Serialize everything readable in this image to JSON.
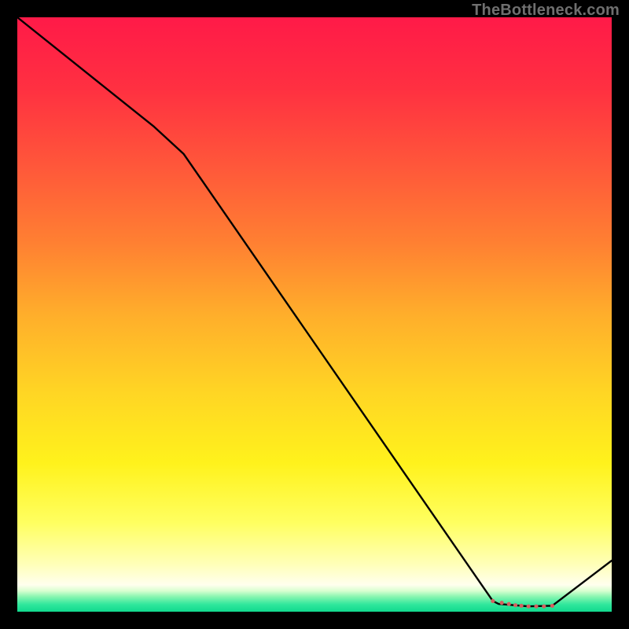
{
  "watermark": "TheBottleneck.com",
  "chart_data": {
    "type": "line",
    "title": "",
    "xlabel": "",
    "ylabel": "",
    "xlim": [
      0,
      100
    ],
    "ylim": [
      0,
      100
    ],
    "background_gradient": {
      "stops": [
        {
          "offset": 0.0,
          "color": "#ff1a48"
        },
        {
          "offset": 0.12,
          "color": "#ff3041"
        },
        {
          "offset": 0.25,
          "color": "#ff573a"
        },
        {
          "offset": 0.38,
          "color": "#ff8032"
        },
        {
          "offset": 0.5,
          "color": "#ffae2b"
        },
        {
          "offset": 0.63,
          "color": "#ffd524"
        },
        {
          "offset": 0.75,
          "color": "#fff21c"
        },
        {
          "offset": 0.85,
          "color": "#ffff60"
        },
        {
          "offset": 0.92,
          "color": "#ffffb8"
        },
        {
          "offset": 0.955,
          "color": "#ffffee"
        },
        {
          "offset": 0.965,
          "color": "#d8ffd0"
        },
        {
          "offset": 0.975,
          "color": "#86f5b0"
        },
        {
          "offset": 0.988,
          "color": "#2fe79c"
        },
        {
          "offset": 1.0,
          "color": "#11d98e"
        }
      ]
    },
    "series": [
      {
        "name": "curve",
        "stroke": "#000000",
        "stroke_width": 2.4,
        "x": [
          0.0,
          12.0,
          23.0,
          28.0,
          80.0,
          81.0,
          86.0,
          90.0,
          100.0
        ],
        "y": [
          100.0,
          90.4,
          81.6,
          77.0,
          1.8,
          1.3,
          0.9,
          1.0,
          8.6
        ]
      }
    ],
    "markers": {
      "name": "bottom-cluster",
      "color": "#d46060",
      "radius": 2.6,
      "x": [
        80.0,
        81.5,
        82.7,
        83.8,
        84.8,
        86.0,
        87.3,
        88.6,
        90.0
      ],
      "y": [
        1.8,
        1.5,
        1.3,
        1.1,
        1.0,
        0.9,
        0.9,
        0.9,
        1.0
      ]
    }
  }
}
